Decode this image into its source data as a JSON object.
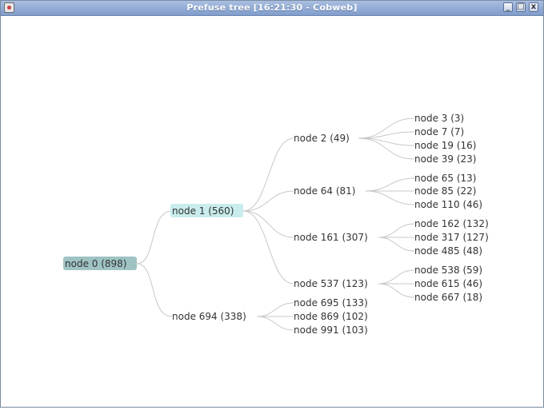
{
  "window": {
    "title": "Prefuse tree [16:21:30 - Cobweb]",
    "controls": {
      "minimize": "_",
      "maximize": "□",
      "close": "x"
    }
  },
  "tree": {
    "root": "node 0  (898)",
    "level1": {
      "n1": "node 1  (560)",
      "n694": "node 694  (338)"
    },
    "level2": {
      "n2": "node 2  (49)",
      "n64": "node 64  (81)",
      "n161": "node 161  (307)",
      "n537": "node 537  (123)",
      "n695": "node 695  (133)",
      "n869": "node 869  (102)",
      "n991": "node 991  (103)"
    },
    "level3": {
      "n3": "node 3  (3)",
      "n7": "node 7  (7)",
      "n19": "node 19  (16)",
      "n39": "node 39  (23)",
      "n65": "node 65  (13)",
      "n85": "node 85  (22)",
      "n110": "node 110  (46)",
      "n162": "node 162  (132)",
      "n317": "node 317  (127)",
      "n485": "node 485  (48)",
      "n538": "node 538  (59)",
      "n615": "node 615  (46)",
      "n667": "node 667  (18)"
    }
  },
  "colors": {
    "root_highlight": "#9fc3c3",
    "selected_highlight": "#c9ecec",
    "edge": "#c8c8c8"
  }
}
